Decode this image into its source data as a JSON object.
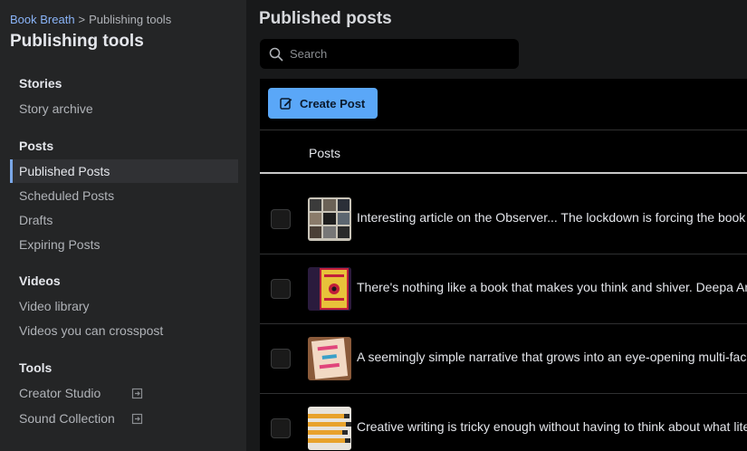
{
  "sidebar": {
    "breadcrumb": {
      "root": "Book Breath",
      "separator": ">",
      "current": "Publishing tools"
    },
    "title": "Publishing tools",
    "sections": {
      "stories": {
        "heading": "Stories",
        "items": [
          "Story archive"
        ]
      },
      "posts": {
        "heading": "Posts",
        "items": [
          "Published Posts",
          "Scheduled Posts",
          "Drafts",
          "Expiring Posts"
        ],
        "active": "Published Posts"
      },
      "videos": {
        "heading": "Videos",
        "items": [
          "Video library",
          "Videos you can crosspost"
        ]
      },
      "tools": {
        "heading": "Tools",
        "items": [
          "Creator Studio",
          "Sound Collection"
        ]
      }
    }
  },
  "main": {
    "title": "Published posts",
    "search": {
      "placeholder": "Search",
      "value": ""
    },
    "create_button": "Create Post",
    "column_header": "Posts",
    "posts": [
      {
        "text": "Interesting article on the Observer... The lockdown is forcing the book t",
        "thumb": "bookshelf-collage"
      },
      {
        "text": "There's nothing like a book that makes you think and shiver. Deepa An",
        "thumb": "djinn-patrol-cover"
      },
      {
        "text": "A seemingly simple narrative that grows into an eye-opening multi-fac",
        "thumb": "such-a-fun-age-cover"
      },
      {
        "text": "Creative writing is tricky enough without having to think about what lite",
        "thumb": "pencils-photo"
      }
    ]
  },
  "colors": {
    "accent": "#5aa7f8",
    "active_indicator": "#7aa7e8",
    "sidebar_bg": "#242526",
    "page_bg": "#18191a",
    "panel_bg": "#000000"
  }
}
